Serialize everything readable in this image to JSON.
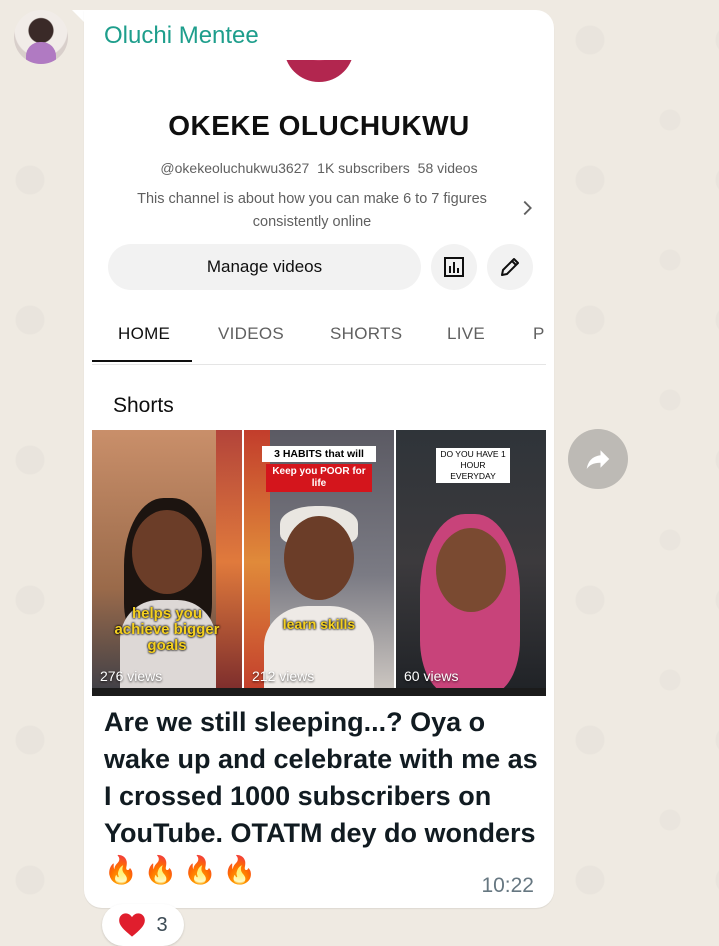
{
  "chat": {
    "sender": "Oluchi Mentee",
    "message_text": "Are we still sleeping...? Oya o wake up and celebrate with me as I crossed 1000 subscribers on YouTube. OTATM dey do wonders",
    "emoji": "🔥🔥🔥🔥",
    "time": "10:22",
    "reaction": {
      "emoji": "❤️",
      "count": "3"
    }
  },
  "youtube": {
    "channel_name": "OKEKE OLUCHUKWU",
    "handle": "@okekeoluchukwu3627",
    "subscribers": "1K subscribers",
    "video_count": "58 videos",
    "description": "This channel is about how you can make 6 to 7 figures consistently online",
    "manage_label": "Manage videos",
    "tabs": [
      "HOME",
      "VIDEOS",
      "SHORTS",
      "LIVE",
      "P"
    ],
    "shorts_heading": "Shorts",
    "shorts": [
      {
        "caption": "helps you achieve bigger goals",
        "views": "276 views"
      },
      {
        "title_line1": "3 HABITS that will",
        "title_line2": "Keep you POOR for life",
        "caption": "learn skills",
        "views": "212 views"
      },
      {
        "title": "DO YOU HAVE 1 HOUR EVERYDAY",
        "views": "60 views"
      }
    ]
  },
  "colors": {
    "sender": "#1e9e8c",
    "chat_bg": "#efeae2",
    "bubble": "#ffffff",
    "caption_yellow": "#f5d020"
  },
  "icons": [
    "analytics-icon",
    "pencil-icon",
    "chevron-right-icon",
    "forward-icon",
    "heart-icon"
  ]
}
